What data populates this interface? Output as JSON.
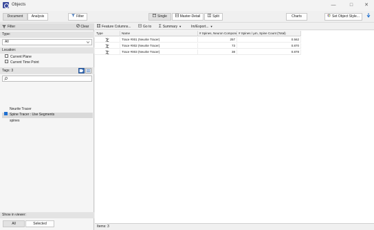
{
  "window": {
    "title": "Objects"
  },
  "toolbar": {
    "document": "Document",
    "analysis": "Analysis",
    "filter": "Filter",
    "single": "Single",
    "master_detail": "Master-Detail",
    "split": "Split",
    "charts": "Charts",
    "set_object_style": "Set Object Style..."
  },
  "left": {
    "filter_label": "Filter",
    "clear_label": "Clear",
    "type_label": "Type:",
    "type_value": "All",
    "location_label": "Location:",
    "current_plane": "Current Plane",
    "current_time_point": "Current Time Point",
    "tags_label": "Tags: 3",
    "tags": [
      {
        "label": "Neurite Tracer",
        "checked": false,
        "selected": false
      },
      {
        "label": "Spine Tracer : Use Segments",
        "checked": true,
        "selected": true
      },
      {
        "label": "spines",
        "checked": false,
        "selected": false
      }
    ],
    "show_in_viewer_label": "Show in viewer:",
    "all_label": "All",
    "selected_label": "Selected"
  },
  "table_toolbar": {
    "feature_columns": "Feature Columns...",
    "go_to": "Go to",
    "summary": "Summary",
    "im_export": "Im/Export..."
  },
  "table": {
    "columns": [
      "Type",
      "Name",
      "# Spines, Neuron Components",
      "# Spines / µm, Spine Count (Total)"
    ],
    "rows": [
      {
        "name": "Trace #001 (Neurite Tracer)",
        "spines": "257",
        "density": "0.562"
      },
      {
        "name": "Trace #002 (Neurite Tracer)",
        "spines": "73",
        "density": "0.870"
      },
      {
        "name": "Trace #003 (Neurite Tracer)",
        "spines": "38",
        "density": "0.878"
      }
    ]
  },
  "status": {
    "items": "Items: 3"
  }
}
